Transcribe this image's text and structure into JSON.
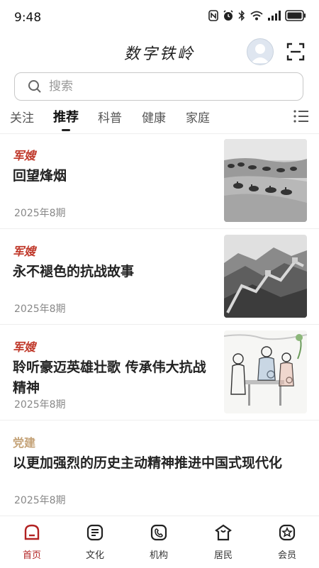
{
  "status": {
    "time": "9:48"
  },
  "header": {
    "title": "数字铁岭"
  },
  "search": {
    "placeholder": "搜索"
  },
  "tabs": [
    {
      "label": "关注"
    },
    {
      "label": "推荐",
      "active": true
    },
    {
      "label": "科普"
    },
    {
      "label": "健康"
    },
    {
      "label": "家庭"
    }
  ],
  "feed": [
    {
      "category": "军嫂",
      "title": "回望烽烟",
      "meta": "2025年8期",
      "thumb": "desert-caravan"
    },
    {
      "category": "军嫂",
      "title": "永不褪色的抗战故事",
      "meta": "2025年8期",
      "thumb": "great-wall"
    },
    {
      "category": "军嫂",
      "title": "聆听豪迈英雄壮歌 传承伟大抗战精神",
      "meta": "2025年8期",
      "thumb": "family-illustration"
    },
    {
      "category": "党建",
      "title": "以更加强烈的历史主动精神推进中国式现代化",
      "meta": "2025年8期"
    }
  ],
  "nav": [
    {
      "label": "首页",
      "icon": "home-icon",
      "active": true
    },
    {
      "label": "文化",
      "icon": "culture-icon"
    },
    {
      "label": "机构",
      "icon": "institution-icon"
    },
    {
      "label": "居民",
      "icon": "residents-icon"
    },
    {
      "label": "会员",
      "icon": "member-icon"
    }
  ],
  "colors": {
    "accent": "#b22222",
    "category": "#c0392b",
    "party_category": "#c4a277"
  }
}
